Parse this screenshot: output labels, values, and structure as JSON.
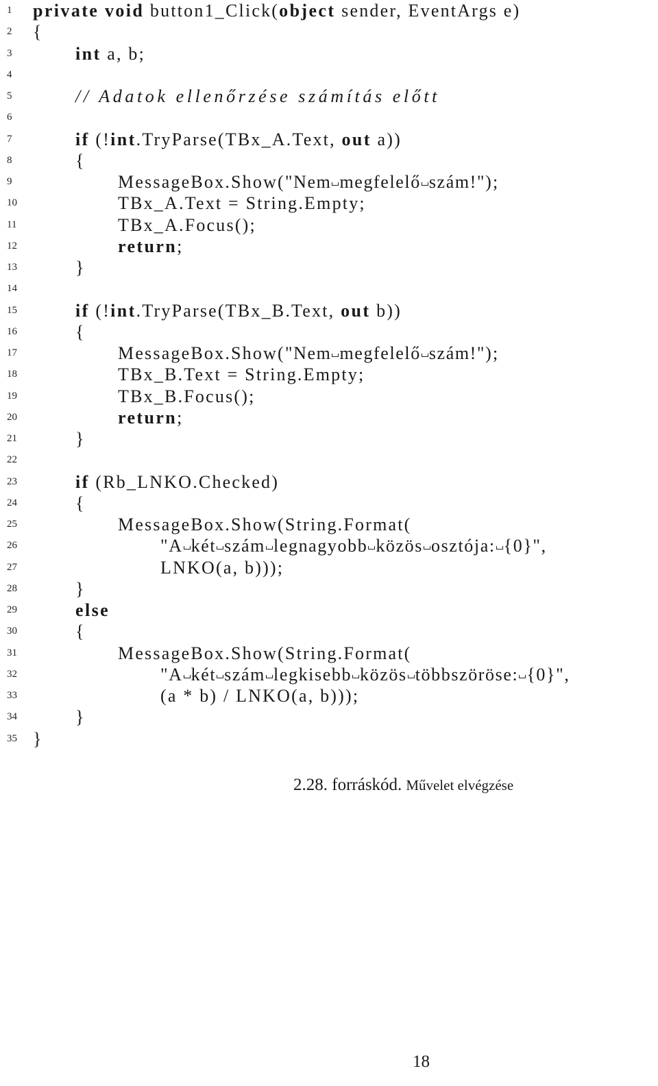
{
  "listing": {
    "lines": [
      {
        "n": "1",
        "indent": 0,
        "tokens": [
          {
            "t": "kw",
            "v": "private"
          },
          {
            "t": "tx",
            "v": " "
          },
          {
            "t": "kw",
            "v": "void"
          },
          {
            "t": "tx",
            "v": " button1_Click("
          },
          {
            "t": "kw",
            "v": "object"
          },
          {
            "t": "tx",
            "v": " sender, EventArgs e)"
          }
        ]
      },
      {
        "n": "2",
        "indent": 0,
        "tokens": [
          {
            "t": "tx",
            "v": "{"
          }
        ]
      },
      {
        "n": "3",
        "indent": 1,
        "tokens": [
          {
            "t": "kw",
            "v": "int"
          },
          {
            "t": "tx",
            "v": " a, b;"
          }
        ]
      },
      {
        "n": "4",
        "indent": 0,
        "tokens": []
      },
      {
        "n": "5",
        "indent": 1,
        "tokens": [
          {
            "t": "cm",
            "v": "// Adatok ellenőrzése számítás előtt"
          }
        ]
      },
      {
        "n": "6",
        "indent": 0,
        "tokens": []
      },
      {
        "n": "7",
        "indent": 1,
        "tokens": [
          {
            "t": "kw",
            "v": "if"
          },
          {
            "t": "tx",
            "v": " (!"
          },
          {
            "t": "kw",
            "v": "int"
          },
          {
            "t": "tx",
            "v": ".TryParse(TBx_A.Text, "
          },
          {
            "t": "kw",
            "v": "out"
          },
          {
            "t": "tx",
            "v": " a))"
          }
        ]
      },
      {
        "n": "8",
        "indent": 1,
        "tokens": [
          {
            "t": "tx",
            "v": "{"
          }
        ]
      },
      {
        "n": "9",
        "indent": 2,
        "tokens": [
          {
            "t": "tx",
            "v": "MessageBox.Show("
          },
          {
            "t": "str",
            "v": "\"Nem megfelelő szám!\""
          },
          {
            "t": "tx",
            "v": ");"
          }
        ]
      },
      {
        "n": "10",
        "indent": 2,
        "tokens": [
          {
            "t": "tx",
            "v": "TBx_A.Text = String.Empty;"
          }
        ]
      },
      {
        "n": "11",
        "indent": 2,
        "tokens": [
          {
            "t": "tx",
            "v": "TBx_A.Focus();"
          }
        ]
      },
      {
        "n": "12",
        "indent": 2,
        "tokens": [
          {
            "t": "kw",
            "v": "return"
          },
          {
            "t": "tx",
            "v": ";"
          }
        ]
      },
      {
        "n": "13",
        "indent": 1,
        "tokens": [
          {
            "t": "tx",
            "v": "}"
          }
        ]
      },
      {
        "n": "14",
        "indent": 0,
        "tokens": []
      },
      {
        "n": "15",
        "indent": 1,
        "tokens": [
          {
            "t": "kw",
            "v": "if"
          },
          {
            "t": "tx",
            "v": " (!"
          },
          {
            "t": "kw",
            "v": "int"
          },
          {
            "t": "tx",
            "v": ".TryParse(TBx_B.Text, "
          },
          {
            "t": "kw",
            "v": "out"
          },
          {
            "t": "tx",
            "v": " b))"
          }
        ]
      },
      {
        "n": "16",
        "indent": 1,
        "tokens": [
          {
            "t": "tx",
            "v": "{"
          }
        ]
      },
      {
        "n": "17",
        "indent": 2,
        "tokens": [
          {
            "t": "tx",
            "v": "MessageBox.Show("
          },
          {
            "t": "str",
            "v": "\"Nem megfelelő szám!\""
          },
          {
            "t": "tx",
            "v": ");"
          }
        ]
      },
      {
        "n": "18",
        "indent": 2,
        "tokens": [
          {
            "t": "tx",
            "v": "TBx_B.Text = String.Empty;"
          }
        ]
      },
      {
        "n": "19",
        "indent": 2,
        "tokens": [
          {
            "t": "tx",
            "v": "TBx_B.Focus();"
          }
        ]
      },
      {
        "n": "20",
        "indent": 2,
        "tokens": [
          {
            "t": "kw",
            "v": "return"
          },
          {
            "t": "tx",
            "v": ";"
          }
        ]
      },
      {
        "n": "21",
        "indent": 1,
        "tokens": [
          {
            "t": "tx",
            "v": "}"
          }
        ]
      },
      {
        "n": "22",
        "indent": 0,
        "tokens": []
      },
      {
        "n": "23",
        "indent": 1,
        "tokens": [
          {
            "t": "kw",
            "v": "if"
          },
          {
            "t": "tx",
            "v": " (Rb_LNKO.Checked)"
          }
        ]
      },
      {
        "n": "24",
        "indent": 1,
        "tokens": [
          {
            "t": "tx",
            "v": "{"
          }
        ]
      },
      {
        "n": "25",
        "indent": 2,
        "tokens": [
          {
            "t": "tx",
            "v": "MessageBox.Show(String.Format("
          }
        ]
      },
      {
        "n": "26",
        "indent": 3,
        "tokens": [
          {
            "t": "str",
            "v": "\"A két szám legnagyobb közös osztója: {0}\""
          },
          {
            "t": "tx",
            "v": ","
          }
        ]
      },
      {
        "n": "27",
        "indent": 3,
        "tokens": [
          {
            "t": "tx",
            "v": "LNKO(a, b)));"
          }
        ]
      },
      {
        "n": "28",
        "indent": 1,
        "tokens": [
          {
            "t": "tx",
            "v": "}"
          }
        ]
      },
      {
        "n": "29",
        "indent": 1,
        "tokens": [
          {
            "t": "kw",
            "v": "else"
          }
        ]
      },
      {
        "n": "30",
        "indent": 1,
        "tokens": [
          {
            "t": "tx",
            "v": "{"
          }
        ]
      },
      {
        "n": "31",
        "indent": 2,
        "tokens": [
          {
            "t": "tx",
            "v": "MessageBox.Show(String.Format("
          }
        ]
      },
      {
        "n": "32",
        "indent": 3,
        "tokens": [
          {
            "t": "str",
            "v": "\"A két szám legkisebb közös többszöröse: {0}\""
          },
          {
            "t": "tx",
            "v": ","
          }
        ]
      },
      {
        "n": "33",
        "indent": 3,
        "tokens": [
          {
            "t": "tx",
            "v": "(a * b) / LNKO(a, b)));"
          }
        ]
      },
      {
        "n": "34",
        "indent": 1,
        "tokens": [
          {
            "t": "tx",
            "v": "}"
          }
        ]
      },
      {
        "n": "35",
        "indent": 0,
        "tokens": [
          {
            "t": "tx",
            "v": "}"
          }
        ]
      }
    ]
  },
  "caption": {
    "label": "2.28. forráskód.",
    "title": "Művelet elvégzése"
  },
  "page_number": "18"
}
